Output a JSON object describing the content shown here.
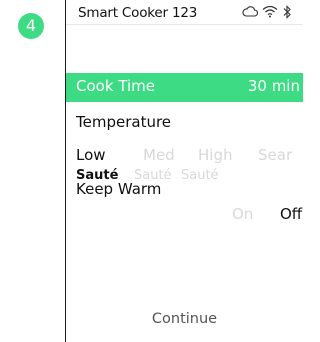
{
  "step_badge": "4",
  "device": {
    "name": "Smart Cooker 123",
    "status_icons": [
      "cloud-icon",
      "wifi-icon",
      "bluetooth-icon"
    ]
  },
  "cook_time": {
    "label": "Cook Time",
    "value": "30 min"
  },
  "temperature": {
    "label": "Temperature",
    "levels": [
      "Low",
      "Med",
      "High",
      "Sear"
    ],
    "level_selected": "Low",
    "modes": [
      "Sauté",
      "Sauté",
      "Sauté"
    ],
    "mode_selected_index": 0
  },
  "keep_warm": {
    "label": "Keep Warm",
    "options": [
      "On",
      "Off"
    ],
    "selected": "Off"
  },
  "continue_label": "Continue",
  "colors": {
    "accent": "#3ddc84",
    "dim_text": "#d8d8d8",
    "text": "#111111"
  }
}
